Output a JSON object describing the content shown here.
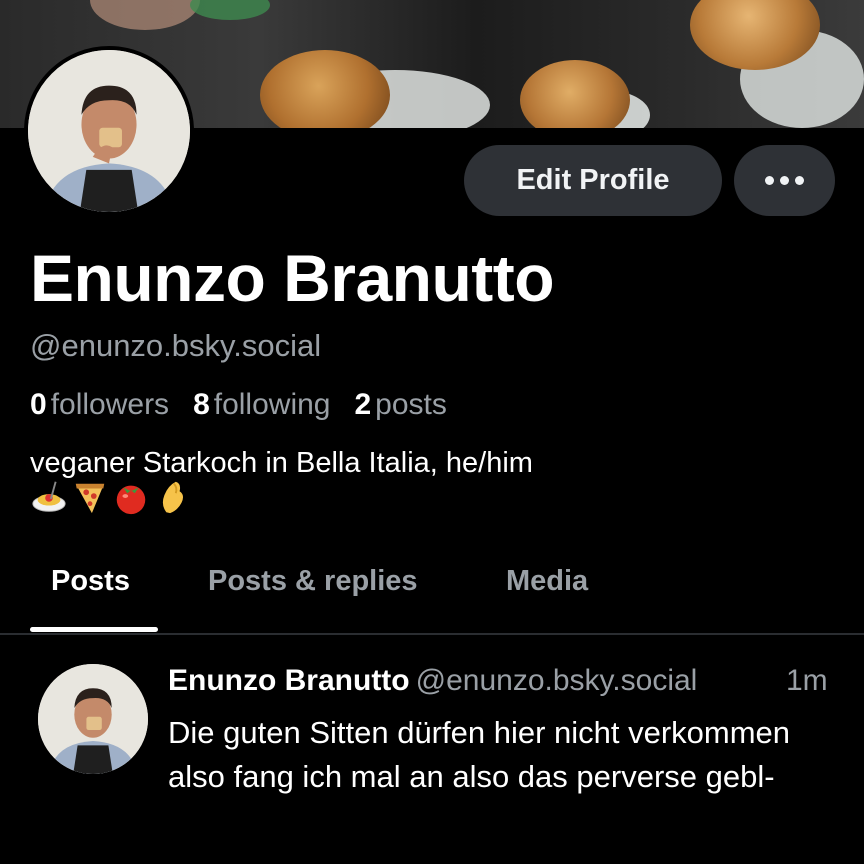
{
  "profile": {
    "display_name": "Enunzo Branutto",
    "handle": "@enunzo.bsky.social",
    "bio": "veganer Starkoch in Bella Italia, he/him",
    "bio_emojis": [
      "spaghetti-icon",
      "pizza-icon",
      "tomato-icon",
      "pinched-fingers-icon"
    ],
    "stats": {
      "followers_count": "0",
      "followers_label": "followers",
      "following_count": "8",
      "following_label": "following",
      "posts_count": "2",
      "posts_label": "posts"
    }
  },
  "actions": {
    "edit_profile_label": "Edit Profile",
    "more_icon": "ellipsis-icon"
  },
  "tabs": [
    {
      "label": "Posts",
      "active": true
    },
    {
      "label": "Posts & replies",
      "active": false
    },
    {
      "label": "Media",
      "active": false
    }
  ],
  "feed": {
    "posts": [
      {
        "author": "Enunzo Branutto",
        "handle": "@enunzo.bsky.social",
        "time": "1m",
        "text": "Die guten Sitten dürfen hier nicht verkommen also fang ich mal an also das perverse gebl-"
      }
    ]
  },
  "colors": {
    "background": "#000000",
    "button_bg": "#2e3136",
    "muted_text": "#9aa0a6",
    "primary_text": "#ffffff"
  }
}
